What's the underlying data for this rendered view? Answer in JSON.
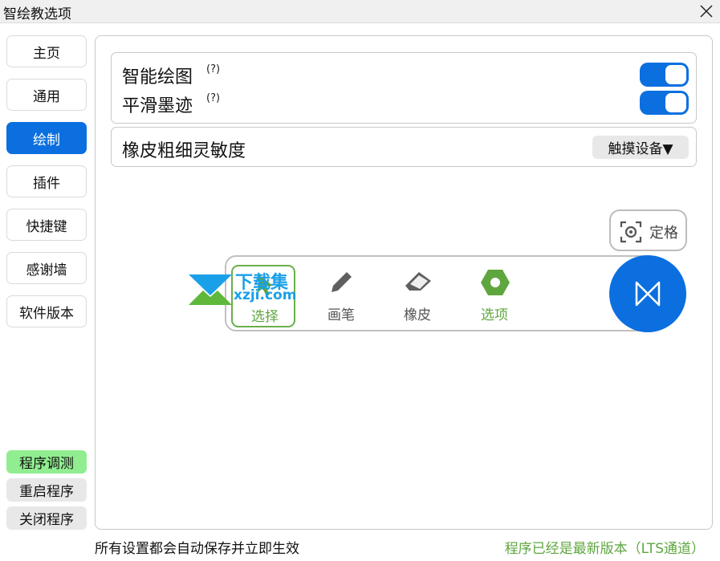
{
  "window": {
    "title": "智绘教选项"
  },
  "sidebar": {
    "items": [
      {
        "label": "主页"
      },
      {
        "label": "通用"
      },
      {
        "label": "绘制"
      },
      {
        "label": "插件"
      },
      {
        "label": "快捷键"
      },
      {
        "label": "感谢墙"
      },
      {
        "label": "软件版本"
      }
    ],
    "active_index": 2,
    "actions": [
      {
        "label": "程序调测"
      },
      {
        "label": "重启程序"
      },
      {
        "label": "关闭程序"
      }
    ]
  },
  "settings": {
    "smart_draw": {
      "label": "智能绘图",
      "help": "(?)",
      "enabled": true
    },
    "smooth_ink": {
      "label": "平滑墨迹",
      "help": "(?)",
      "enabled": true
    },
    "eraser_sensitivity": {
      "label": "橡皮粗细灵敏度",
      "selected": "触摸设备▼"
    }
  },
  "preview": {
    "lock_label": "定格",
    "tools": [
      {
        "label": "选择",
        "icon": "select-icon",
        "selected": true
      },
      {
        "label": "画笔",
        "icon": "pen-icon"
      },
      {
        "label": "橡皮",
        "icon": "eraser-icon"
      },
      {
        "label": "选项",
        "icon": "settings-hex-icon"
      }
    ],
    "watermark": {
      "line1": "下载集",
      "line2": "xzji.com"
    }
  },
  "footer": {
    "left": "所有设置都会自动保存并立即生效",
    "right": "程序已经是最新版本（LTS通道）"
  },
  "colors": {
    "accent": "#0b6fdf",
    "green": "#5fa63f",
    "debug": "#90ee90"
  }
}
